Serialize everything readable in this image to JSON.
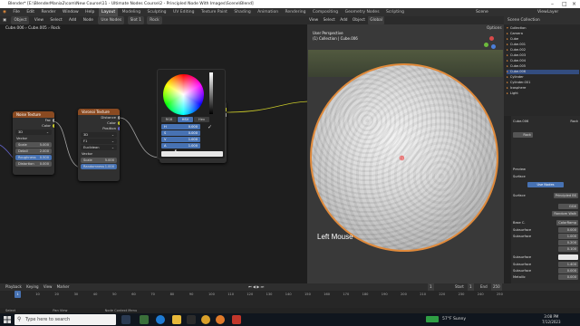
{
  "window": {
    "title": "Blender* [E:\\BlenderMania2\\com\\New Course\\11 - Ultimate Nodes Course\\2 - Principled Node With Images\\Scene\\Blend]"
  },
  "top_menu": {
    "items": [
      "File",
      "Edit",
      "Render",
      "Window",
      "Help"
    ],
    "workspaces": [
      "Layout",
      "Modeling",
      "Sculpting",
      "UV Editing",
      "Texture Paint",
      "Shading",
      "Animation",
      "Rendering",
      "Compositing",
      "Geometry Nodes",
      "Scripting"
    ],
    "active_workspace": "Layout",
    "scene": "Scene",
    "view_layer": "ViewLayer"
  },
  "node_editor": {
    "header_items": [
      "Object",
      "View",
      "Select",
      "Add",
      "Node"
    ],
    "use_nodes_label": "Use Nodes",
    "slot": "Slot 1",
    "material": "Rock",
    "breadcrumbs": [
      "Cube.006",
      "Cube.005",
      "Rock"
    ],
    "noise_node": {
      "title": "Noise Texture",
      "outputs": [
        "Fac",
        "Color"
      ],
      "mode": "3D",
      "vector_label": "Vector",
      "fields": [
        {
          "label": "Scale",
          "value": "5.000"
        },
        {
          "label": "Detail",
          "value": "2.000"
        },
        {
          "label": "Roughness",
          "value": "0.500"
        },
        {
          "label": "Distortion",
          "value": "0.000"
        }
      ]
    },
    "voronoi_node": {
      "title": "Voronoi Texture",
      "outputs": [
        "Distance",
        "Color",
        "Position"
      ],
      "dimensions": "3D",
      "feature": "F1",
      "metric": "Euclidean",
      "vector_label": "Vector",
      "fields": [
        {
          "label": "Scale",
          "value": "5.000"
        },
        {
          "label": "Randomness",
          "value": "1.000"
        }
      ]
    },
    "ramp_node": {
      "outputs": [
        "Color",
        "Alpha"
      ],
      "input": "Fac"
    },
    "color_picker": {
      "tabs": [
        "RGB",
        "HSV",
        "Hex"
      ],
      "active_tab": "HSV",
      "fields": [
        {
          "label": "H",
          "value": "0.000"
        },
        {
          "label": "S",
          "value": "0.000"
        },
        {
          "label": "V",
          "value": "1.000"
        },
        {
          "label": "A",
          "value": "1.000"
        }
      ]
    }
  },
  "viewport": {
    "header_items": [
      "View",
      "Select",
      "Add",
      "Object"
    ],
    "orientation": "Global",
    "options_label": "Options",
    "perspective": "User Perspective",
    "collection": "(1) Collection | Cube.006",
    "overlay_text": "Left Mouse"
  },
  "outliner": {
    "title": "Scene Collection",
    "items": [
      {
        "name": "Collection",
        "selected": false
      },
      {
        "name": "Camera",
        "selected": false
      },
      {
        "name": "Cube",
        "selected": false
      },
      {
        "name": "Cube.001",
        "selected": false
      },
      {
        "name": "Cube.002",
        "selected": false
      },
      {
        "name": "Cube.003",
        "selected": false
      },
      {
        "name": "Cube.004",
        "selected": false
      },
      {
        "name": "Cube.005",
        "selected": false
      },
      {
        "name": "Cube.006",
        "selected": true
      },
      {
        "name": "Cylinder",
        "selected": false
      },
      {
        "name": "Cylinder.001",
        "selected": false
      },
      {
        "name": "Icosphere",
        "selected": false
      },
      {
        "name": "Light",
        "selected": false
      }
    ]
  },
  "properties": {
    "object_name": "Cube.006",
    "material_name": "Rock",
    "material_slot": "Rock",
    "preview_label": "Preview",
    "surface_label": "Surface",
    "use_nodes_button": "Use Nodes",
    "surface_shader": "Principled BS",
    "distribution": "GGX",
    "subsurface_method": "Random Walk",
    "base_color_label": "Base C.",
    "base_color_value": "ColorRamp",
    "rows": [
      {
        "label": "Subsurface",
        "value": "0.000"
      },
      {
        "label": "Subsurface",
        "value": "1.000"
      },
      {
        "label": "",
        "value": "0.200"
      },
      {
        "label": "",
        "value": "0.100"
      },
      {
        "label": "Subsurface",
        "value": ""
      },
      {
        "label": "Subsurface",
        "value": "1.400"
      },
      {
        "label": "Subsurface",
        "value": "0.000"
      },
      {
        "label": "Metallic",
        "value": "0.000"
      },
      {
        "label": "Specular",
        "value": "0.500"
      },
      {
        "label": "Specular T.",
        "value": "0.000"
      },
      {
        "label": "Roughness",
        "value": "0.500"
      }
    ]
  },
  "timeline": {
    "header_items": [
      "Playback",
      "Keying",
      "View",
      "Marker"
    ],
    "current_frame": "1",
    "start_label": "Start",
    "start": "1",
    "end_label": "End",
    "end": "250",
    "ruler": [
      "1",
      "10",
      "20",
      "30",
      "40",
      "50",
      "60",
      "70",
      "80",
      "90",
      "100",
      "110",
      "120",
      "130",
      "140",
      "150",
      "160",
      "170",
      "180",
      "190",
      "200",
      "210",
      "220",
      "230",
      "240",
      "250"
    ]
  },
  "statusbar": {
    "items": [
      "Select",
      "Pan View",
      "Node Context Menu"
    ]
  },
  "taskbar": {
    "search_placeholder": "Type here to search",
    "weather": "57°F Sunny",
    "time": "3:08 PM",
    "date": "7/12/2023",
    "accent": "#4772b3"
  }
}
